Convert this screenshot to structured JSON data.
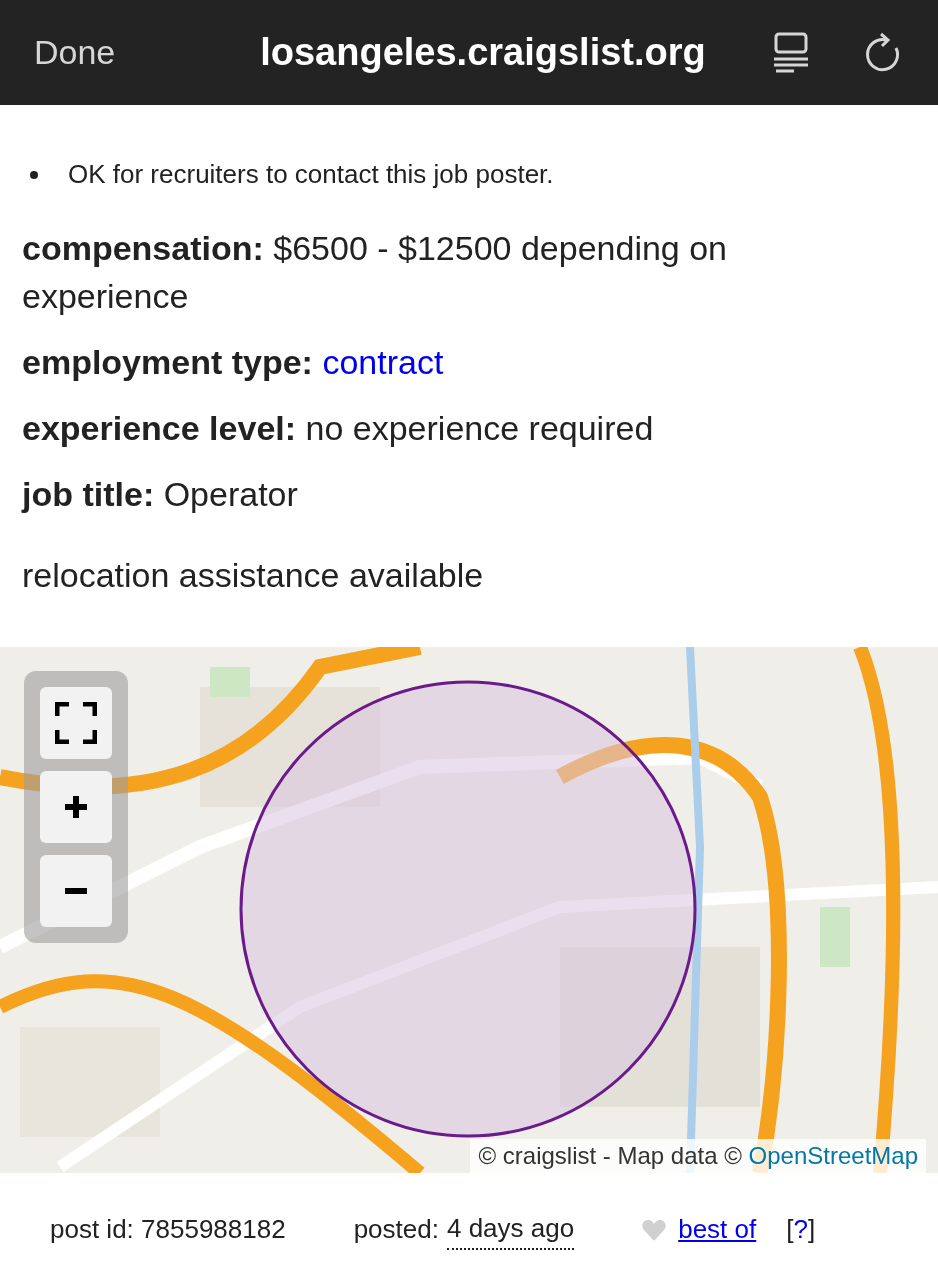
{
  "browser_bar": {
    "done": "Done",
    "url": "losangeles.craigslist.org"
  },
  "notices": [
    "OK for recruiters to contact this job poster."
  ],
  "attributes": [
    {
      "label": "compensation:",
      "value": "$6500 - $12500 depending on experience",
      "kind": "text"
    },
    {
      "label": "employment type:",
      "value": "contract",
      "kind": "link"
    },
    {
      "label": "experience level:",
      "value": "no experience required",
      "kind": "text"
    },
    {
      "label": "job title:",
      "value": "Operator",
      "kind": "text"
    }
  ],
  "relocation": "relocation assistance available",
  "map": {
    "kind": "picture",
    "attribution": "© craigslist - Map data © ",
    "attribution_link": "OpenStreetMap"
  },
  "footer": {
    "post_id": "post id: 7855988182",
    "posted_label": "posted:",
    "posted_value": "4 days ago",
    "best_of": "best of",
    "help_open": "[",
    "help": "?",
    "help_close": "]"
  }
}
